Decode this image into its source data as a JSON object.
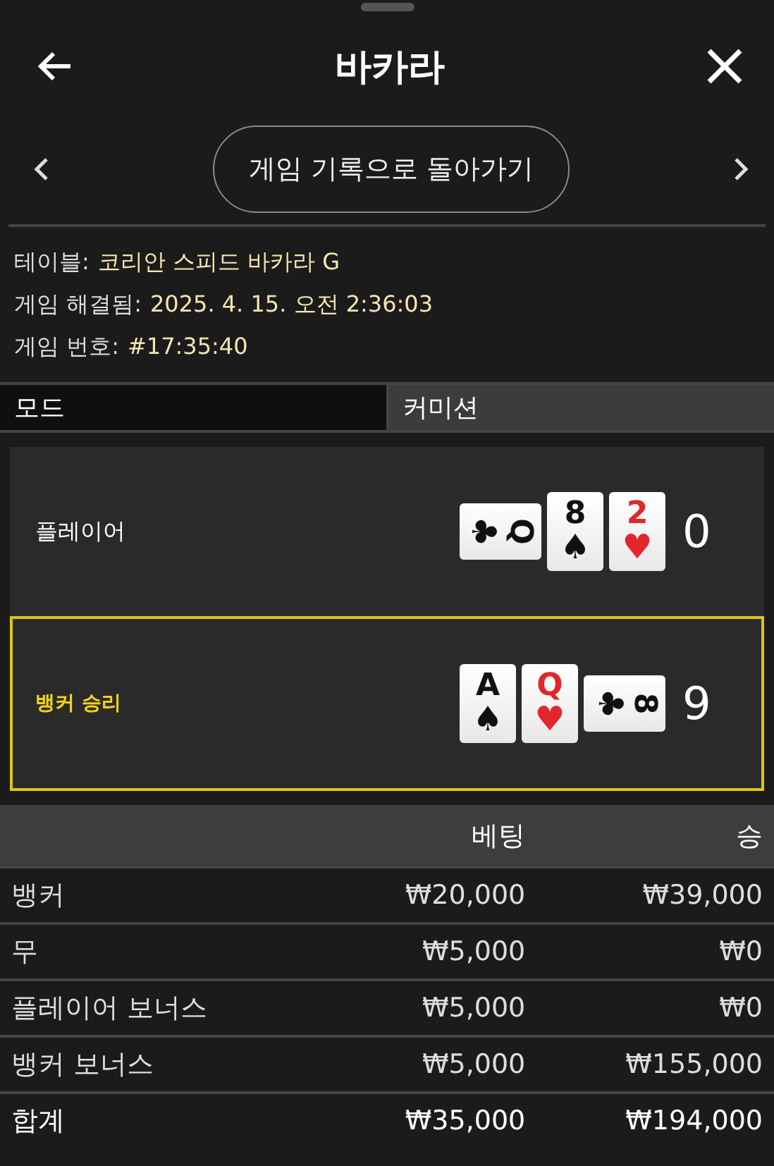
{
  "header": {
    "title": "바카라"
  },
  "nav": {
    "button": "게임 기록으로 돌아가기"
  },
  "info": [
    {
      "label": "테이블:",
      "value": "코리안 스피드 바카라 G"
    },
    {
      "label": "게임 해결됨:",
      "value": "2025. 4. 15. 오전 2:36:03"
    },
    {
      "label": "게임 번호:",
      "value": "#17:35:40"
    }
  ],
  "mode": {
    "label": "모드",
    "value": "커미션"
  },
  "hands": [
    {
      "name": "플레이어",
      "winner": false,
      "score": "0",
      "cards": [
        {
          "rank": "Q",
          "suit": "♣",
          "color": "#111111",
          "sideways": true
        },
        {
          "rank": "8",
          "suit": "♠",
          "color": "#111111",
          "sideways": false
        },
        {
          "rank": "2",
          "suit": "♥",
          "color": "#e3262b",
          "sideways": false
        }
      ]
    },
    {
      "name": "뱅커 승리",
      "winner": true,
      "score": "9",
      "cards": [
        {
          "rank": "A",
          "suit": "♠",
          "color": "#111111",
          "sideways": false
        },
        {
          "rank": "Q",
          "suit": "♥",
          "color": "#e3262b",
          "sideways": false
        },
        {
          "rank": "8",
          "suit": "♣",
          "color": "#111111",
          "sideways": true
        }
      ]
    }
  ],
  "bets": {
    "columns": [
      "베팅",
      "승"
    ],
    "rows": [
      {
        "name": "뱅커",
        "bet": "₩20,000",
        "win": "₩39,000"
      },
      {
        "name": "무",
        "bet": "₩5,000",
        "win": "₩0"
      },
      {
        "name": "플레이어 보너스",
        "bet": "₩5,000",
        "win": "₩0"
      },
      {
        "name": "뱅커 보너스",
        "bet": "₩5,000",
        "win": "₩155,000"
      }
    ],
    "total": {
      "name": "합계",
      "bet": "₩35,000",
      "win": "₩194,000"
    }
  }
}
